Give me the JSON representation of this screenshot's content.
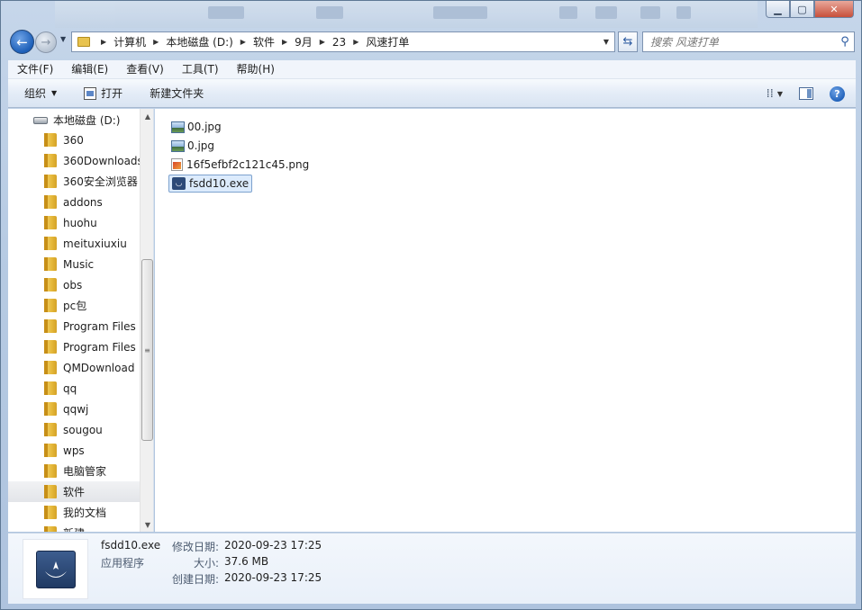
{
  "window": {
    "controls": {
      "minimize": "▁",
      "maximize": "▢",
      "close": "✕"
    }
  },
  "nav": {
    "back_icon": "←",
    "forward_icon": "→",
    "dropdown_icon": "▼",
    "breadcrumbs": [
      "计算机",
      "本地磁盘 (D:)",
      "软件",
      "9月",
      "23",
      "风速打单"
    ],
    "crumb_sep": "▶",
    "refresh_icon": "⇆",
    "search_placeholder": "搜索 风速打单",
    "search_icon": "⚲"
  },
  "menu": [
    "文件(F)",
    "编辑(E)",
    "查看(V)",
    "工具(T)",
    "帮助(H)"
  ],
  "commands": {
    "organize": "组织",
    "organize_arrow": "▼",
    "open": "打开",
    "new_folder": "新建文件夹",
    "view_icon": "⁞⁞",
    "view_arrow": "▼",
    "help": "?"
  },
  "tree": {
    "drive": "本地磁盘 (D:)",
    "items": [
      {
        "label": "360"
      },
      {
        "label": "360Downloads"
      },
      {
        "label": "360安全浏览器"
      },
      {
        "label": "addons"
      },
      {
        "label": "huohu"
      },
      {
        "label": "meituxiuxiu"
      },
      {
        "label": "Music"
      },
      {
        "label": "obs"
      },
      {
        "label": "pc包"
      },
      {
        "label": "Program Files"
      },
      {
        "label": "Program Files"
      },
      {
        "label": "QMDownload"
      },
      {
        "label": "qq"
      },
      {
        "label": "qqwj"
      },
      {
        "label": "sougou"
      },
      {
        "label": "wps"
      },
      {
        "label": "电脑管家"
      },
      {
        "label": "软件",
        "selected": true
      },
      {
        "label": "我的文档"
      },
      {
        "label": "新建..."
      }
    ],
    "scroll_up": "▲",
    "scroll_down": "▼",
    "scroll_grip": "≡"
  },
  "files": [
    {
      "name": "00.jpg",
      "type": "image"
    },
    {
      "name": "0.jpg",
      "type": "image"
    },
    {
      "name": "16f5efbf2c121c45.png",
      "type": "png"
    },
    {
      "name": "fsdd10.exe",
      "type": "exe",
      "selected": true
    }
  ],
  "details": {
    "name": "fsdd10.exe",
    "type": "应用程序",
    "modified_label": "修改日期:",
    "modified": "2020-09-23 17:25",
    "size_label": "大小:",
    "size": "37.6 MB",
    "created_label": "创建日期:",
    "created": "2020-09-23 17:25"
  }
}
